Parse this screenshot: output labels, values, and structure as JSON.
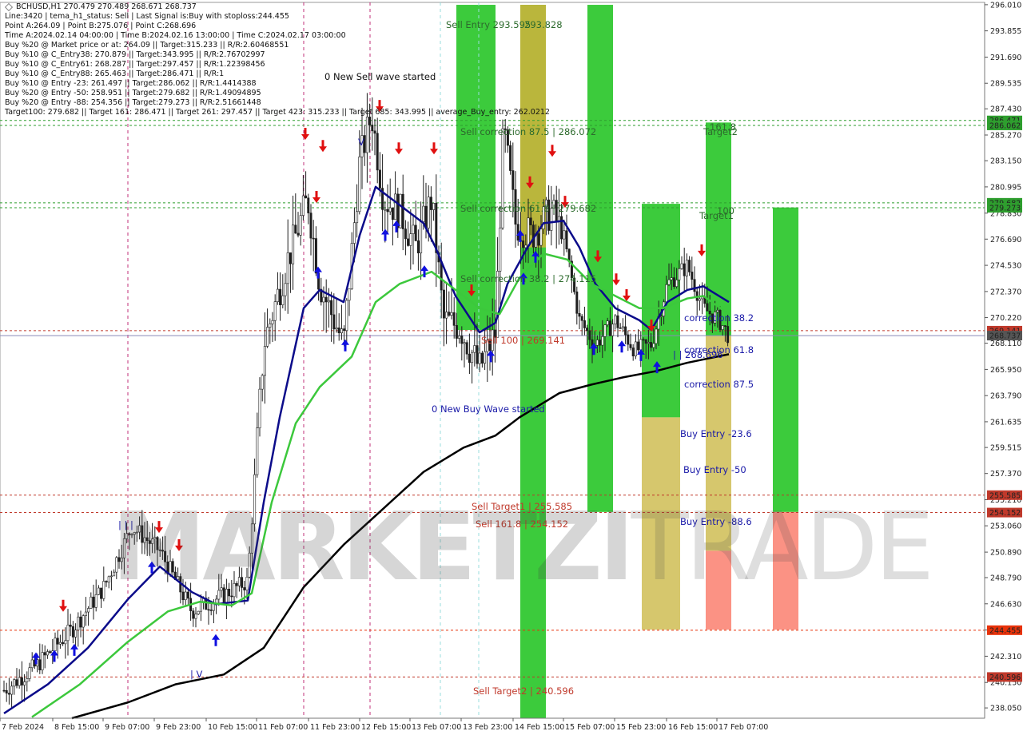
{
  "info_lines": [
    "BCHUSD,H1  270.479 270.489 268.671 268.737",
    "Line:3420 | tema_h1_status: Sell | Last Signal is:Buy with stoploss:244.455",
    "Point A:264.09 | Point B:275.076 | Point C:268.696",
    "Time A:2024.02.14 04:00:00 | Time B:2024.02.16 13:00:00 | Time C:2024.02.17 03:00:00",
    "Buy %20 @ Market price or at: 264.09 || Target:315.233 || R/R:2.60468551",
    "Buy %10 @ C_Entry38: 270.879 || Target:343.995 || R/R:2.76702997",
    "Buy %10 @ C_Entry61: 268.287 || Target:297.457 || R/R:1.22398456",
    "Buy %10 @ C_Entry88: 265.463 || Target:286.471 || R/R:1",
    "Buy %10 @ Entry -23: 261.497 || Target:286.062 || R/R:1.4414388",
    "Buy %20 @ Entry -50: 258.951 || Target:279.682 || R/R:1.49094895",
    "Buy %20 @ Entry -88: 254.356 || Target:279.273 || R/R:2.51661448",
    "Target100: 279.682 || Target 161: 286.471 || Target 261: 297.457 || Target 423: 315.233 || Target 685: 343.995 || average_Buy_entry: 262.0212"
  ],
  "watermark": {
    "main": "MARKETZI",
    "thin": "TRADE"
  },
  "chart_data": {
    "type": "candlestick",
    "symbol": "BCHUSD",
    "timeframe": "H1",
    "y_axis": {
      "ylim": [
        237.2,
        296.2
      ],
      "ticks": [
        "296.010",
        "293.855",
        "291.690",
        "289.535",
        "287.430",
        "285.270",
        "283.150",
        "280.995",
        "278.830",
        "276.690",
        "274.530",
        "272.370",
        "270.220",
        "268.110",
        "265.950",
        "263.790",
        "261.635",
        "259.515",
        "257.370",
        "255.210",
        "253.060",
        "250.890",
        "248.790",
        "246.630",
        "244.470",
        "242.310",
        "240.150",
        "238.050"
      ]
    },
    "x_axis": {
      "ticks": [
        "7 Feb 2024",
        "8 Feb 15:00",
        "9 Feb 07:00",
        "9 Feb 23:00",
        "10 Feb 15:00",
        "11 Feb 07:00",
        "11 Feb 23:00",
        "12 Feb 15:00",
        "13 Feb 07:00",
        "13 Feb 23:00",
        "14 Feb 15:00",
        "15 Feb 07:00",
        "15 Feb 23:00",
        "16 Feb 15:00",
        "17 Feb 07:00"
      ]
    },
    "price_tags": [
      {
        "text": "286.471",
        "value": 286.471,
        "color": "#2e9e2e"
      },
      {
        "text": "286.062",
        "value": 286.062,
        "color": "#2e9e2e"
      },
      {
        "text": "279.682",
        "value": 279.682,
        "color": "#2e9e2e"
      },
      {
        "text": "279.273",
        "value": 279.273,
        "color": "#2e9e2e"
      },
      {
        "text": "269.141",
        "value": 269.141,
        "color": "#c0392b"
      },
      {
        "text": "268.737",
        "value": 268.737,
        "color": "#555555"
      },
      {
        "text": "255.585",
        "value": 255.585,
        "color": "#c0392b"
      },
      {
        "text": "254.152",
        "value": 254.152,
        "color": "#c0392b"
      },
      {
        "text": "244.455",
        "value": 244.455,
        "color": "#e8320a"
      },
      {
        "text": "240.596",
        "value": 240.596,
        "color": "#c0392b"
      }
    ],
    "annotations": [
      {
        "text": "Sell Entry 293.595",
        "color": "#2d6b2d"
      },
      {
        "text": "293.828",
        "color": "#2d6b2d"
      },
      {
        "text": "0 New Sell wave started",
        "color": "#111111"
      },
      {
        "text": "Sell correction 87.5 | 286.072",
        "color": "#2d6b2d"
      },
      {
        "text": "Sell correction 61.8 | 279.682",
        "color": "#2d6b2d"
      },
      {
        "text": "Sell correction 38.2 | 274.115",
        "color": "#2d6b2d"
      },
      {
        "text": "Sell 100 | 269.141",
        "color": "#c0392b"
      },
      {
        "text": "0 New Buy Wave started",
        "color": "#1a1aa8"
      },
      {
        "text": "Sell Target1 | 255.585",
        "color": "#c0392b"
      },
      {
        "text": "Sell 161.8 | 254.152",
        "color": "#c0392b"
      },
      {
        "text": "Sell Target2 | 240.596",
        "color": "#c0392b"
      },
      {
        "text": "Target2",
        "color": "#2d6b2d"
      },
      {
        "text": "161.8",
        "color": "#2d6b2d"
      },
      {
        "text": "Target1",
        "color": "#2d6b2d"
      },
      {
        "text": "100",
        "color": "#2d6b2d"
      },
      {
        "text": "correction 38.2",
        "color": "#1a1aa8"
      },
      {
        "text": "correction 61.8",
        "color": "#1a1aa8"
      },
      {
        "text": "| | 268.696",
        "color": "#1a1aa8"
      },
      {
        "text": "correction 87.5",
        "color": "#1a1aa8"
      },
      {
        "text": "Buy Entry -23.6",
        "color": "#1a1aa8"
      },
      {
        "text": "Buy Entry -50",
        "color": "#1a1aa8"
      },
      {
        "text": "Buy Entry -88.6",
        "color": "#1a1aa8"
      },
      {
        "text": "| | |",
        "color": "#1a1aa8"
      },
      {
        "text": "| V",
        "color": "#1a1aa8"
      },
      {
        "text": "V",
        "color": "#1a1aa8"
      }
    ],
    "ma_colors": {
      "fast": "#0b0b8a",
      "mid": "#3cc83c",
      "slow": "#000000"
    },
    "zone_colors": {
      "green": "#32c832",
      "amber": "#c8b43c",
      "red": "#fa6450"
    },
    "current_price": 268.737,
    "grid": false
  }
}
